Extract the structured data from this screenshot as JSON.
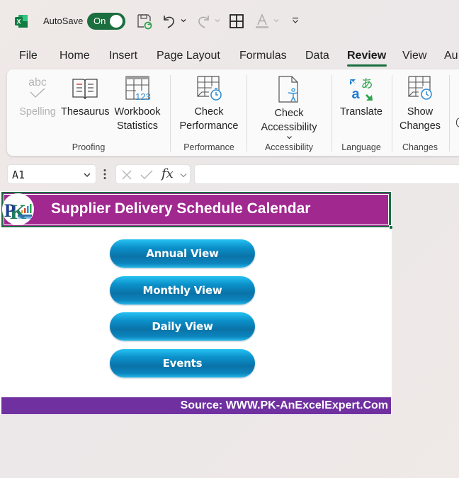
{
  "titlebar": {
    "app_icon": "excel-icon",
    "autosave_label": "AutoSave",
    "autosave_state": "On",
    "quick_access": [
      "save-sync-icon",
      "undo-icon",
      "redo-icon",
      "borders-icon",
      "font-color-icon",
      "customize-qat-icon"
    ]
  },
  "tabs": {
    "items": [
      "File",
      "Home",
      "Insert",
      "Page Layout",
      "Formulas",
      "Data",
      "Review",
      "View",
      "Au"
    ],
    "active": "Review"
  },
  "ribbon": {
    "groups": [
      {
        "label": "Proofing",
        "buttons": [
          {
            "label": "Spelling",
            "icon": "spelling-icon",
            "disabled": true
          },
          {
            "label": "Thesaurus",
            "icon": "thesaurus-icon"
          },
          {
            "label_line1": "Workbook",
            "label_line2": "Statistics",
            "icon": "workbook-statistics-icon"
          }
        ]
      },
      {
        "label": "Performance",
        "buttons": [
          {
            "label_line1": "Check",
            "label_line2": "Performance",
            "icon": "check-performance-icon"
          }
        ]
      },
      {
        "label": "Accessibility",
        "buttons": [
          {
            "label_line1": "Check",
            "label_line2": "Accessibility",
            "icon": "check-accessibility-icon"
          }
        ]
      },
      {
        "label": "Language",
        "buttons": [
          {
            "label": "Translate",
            "icon": "translate-icon"
          }
        ]
      },
      {
        "label": "Changes",
        "buttons": [
          {
            "label_line1": "Show",
            "label_line2": "Changes",
            "icon": "show-changes-icon"
          }
        ]
      }
    ]
  },
  "formula_bar": {
    "name_box": "A1",
    "formula_value": ""
  },
  "sheet": {
    "title": "Supplier Delivery Schedule Calendar",
    "buttons": [
      "Annual View",
      "Monthly View",
      "Daily View",
      "Events"
    ],
    "footer": "Source: WWW.PK-AnExcelExpert.Com",
    "colors": {
      "title_banner": "#a0288f",
      "footer_banner": "#7030a0",
      "button": "#0a8ac2",
      "selection": "#1d6b43"
    }
  }
}
